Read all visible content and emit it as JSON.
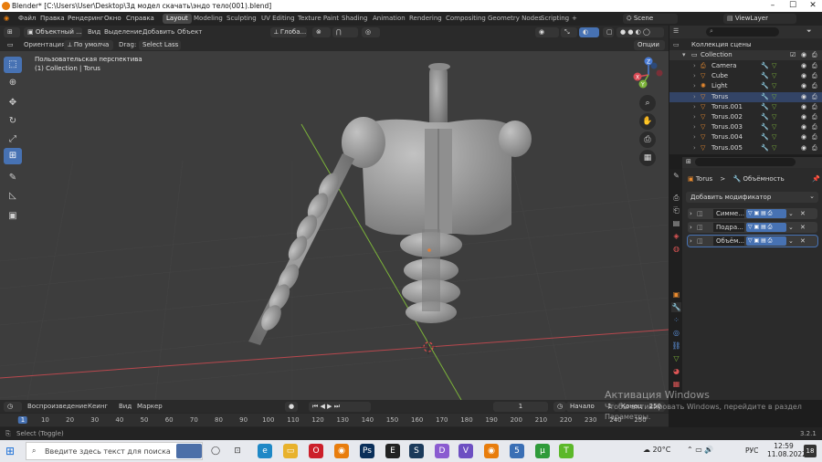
{
  "window": {
    "title": "Blender* [C:\\Users\\User\\Desktop\\3д модел скачать\\эндо тело(001).blend]"
  },
  "menubar": {
    "menus": [
      "Файл",
      "Правка",
      "Рендеринг",
      "Окно",
      "Справка"
    ],
    "tabs": [
      "Layout",
      "Modeling",
      "Sculpting",
      "UV Editing",
      "Texture Paint",
      "Shading",
      "Animation",
      "Rendering",
      "Compositing",
      "Geometry Nodes",
      "Scripting"
    ],
    "add_tab": "+",
    "scene": "Scene",
    "view_layer": "ViewLayer"
  },
  "viewport_header": {
    "mode": "Объектный ...",
    "menus": [
      "Вид",
      "Выделение",
      "Добавить",
      "Объект"
    ],
    "transform": "Глоба...",
    "options": "Опции"
  },
  "tool_header": {
    "orientation_label": "Ориентация:",
    "orientation_value": "По умолча",
    "drag_label": "Drag:",
    "drag_value": "Select Lass"
  },
  "viewport": {
    "view_name": "Пользовательская перспектива",
    "collection_info": "(1) Collection | Torus",
    "gizmo": {
      "x": "X",
      "y": "Y",
      "z": "Z"
    }
  },
  "outliner": {
    "search_placeholder": "",
    "root": "Коллекция сцены",
    "collection": "Collection",
    "items": [
      {
        "name": "Camera",
        "icon": "camera-icon"
      },
      {
        "name": "Cube",
        "icon": "mesh-icon"
      },
      {
        "name": "Light",
        "icon": "light-icon"
      },
      {
        "name": "Torus",
        "icon": "mesh-icon"
      },
      {
        "name": "Torus.001",
        "icon": "mesh-icon"
      },
      {
        "name": "Torus.002",
        "icon": "mesh-icon"
      },
      {
        "name": "Torus.003",
        "icon": "mesh-icon"
      },
      {
        "name": "Torus.004",
        "icon": "mesh-icon"
      },
      {
        "name": "Torus.005",
        "icon": "mesh-icon"
      }
    ]
  },
  "properties": {
    "breadcrumb_object": "Torus",
    "breadcrumb_sep": ">",
    "breadcrumb_modifier": "Объёмность",
    "add_modifier": "Добавить модификатор",
    "modifiers": [
      "Симме...",
      "Подра...",
      "Объём..."
    ]
  },
  "timeline": {
    "menus": [
      "Воспроизведение",
      "Кеинг",
      "Вид",
      "Маркер"
    ],
    "current_frame": "1",
    "start_label": "Начало",
    "start_value": "1",
    "end_label": "Конец",
    "end_value": "250",
    "ruler": [
      "1",
      "10",
      "20",
      "30",
      "40",
      "50",
      "60",
      "70",
      "80",
      "90",
      "100",
      "110",
      "120",
      "130",
      "140",
      "150",
      "160",
      "170",
      "180",
      "190",
      "200",
      "210",
      "220",
      "230",
      "240",
      "250"
    ]
  },
  "activation": {
    "title": "Активация Windows",
    "subtitle": "Чтобы активировать Windows, перейдите в раздел",
    "subtitle2": "Параметры."
  },
  "statusbar": {
    "left": "Select (Toggle)",
    "version": "3.2.1"
  },
  "taskbar": {
    "search_placeholder": "Введите здесь текст для поиска",
    "weather": "20°C",
    "lang": "РУС",
    "time": "12:59",
    "date": "11.08.2022",
    "notifications": "18"
  },
  "colors": {
    "accent": "#4772b3",
    "header": "#2a2a2a",
    "viewport": "#3d3d3d",
    "x_axis": "#b8484e",
    "y_axis": "#7cb33a"
  }
}
